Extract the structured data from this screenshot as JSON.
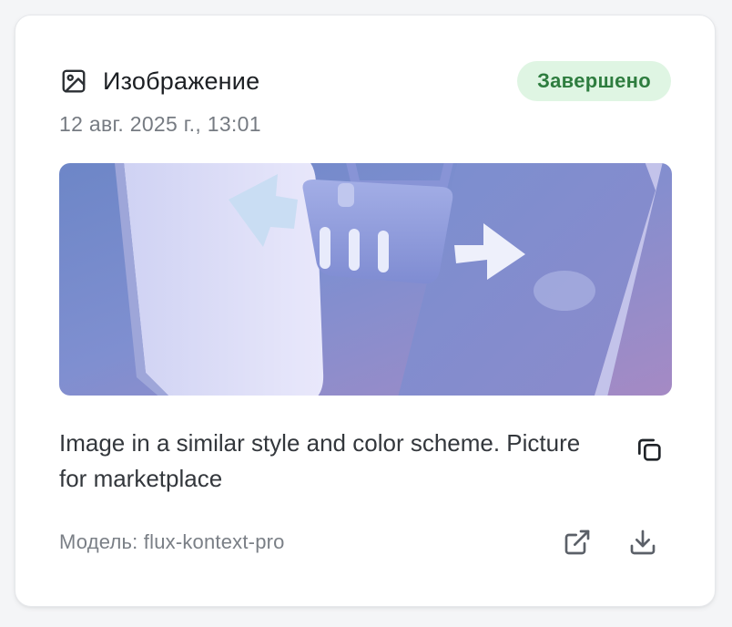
{
  "card": {
    "type_label": "Изображение",
    "type_icon": "image-icon",
    "status": "Завершено",
    "status_color": "#2e7d3f",
    "status_bg": "#dff5e3",
    "date": "12 авг. 2025 г., 13:01",
    "prompt": "Image in a similar style and color scheme. Picture for marketplace",
    "model_label": "Модель: flux-kontext-pro",
    "actions": {
      "copy_icon": "copy-icon",
      "open_icon": "external-link-icon",
      "download_icon": "download-icon"
    }
  }
}
